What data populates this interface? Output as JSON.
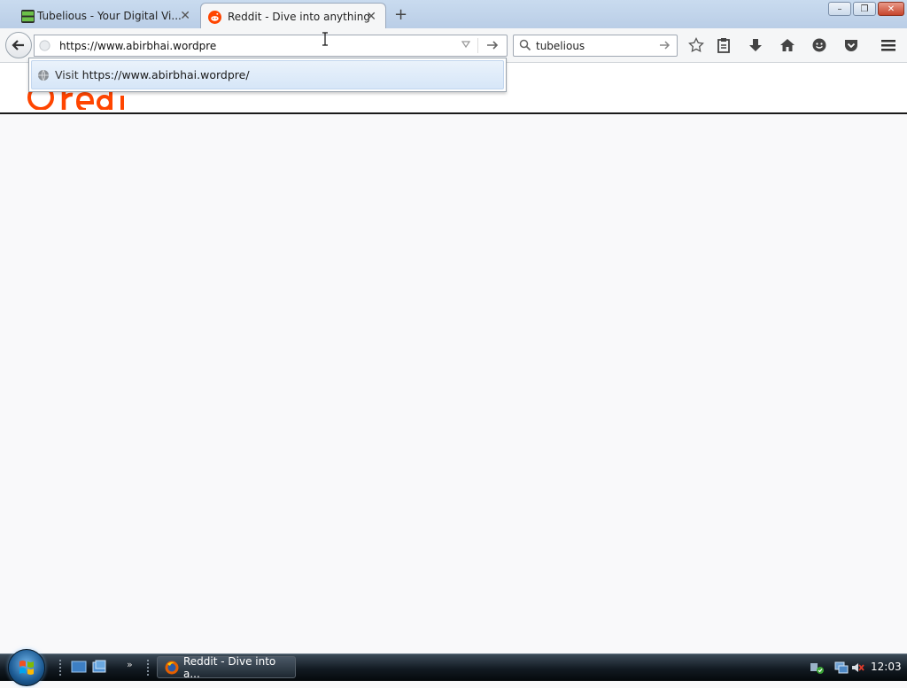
{
  "tabs": [
    {
      "title": "Tubelious - Your Digital Vi...",
      "favicon": "tubelious-favicon",
      "active": false
    },
    {
      "title": "Reddit - Dive into anything",
      "favicon": "reddit-favicon",
      "active": true
    }
  ],
  "new_tab_label": "+",
  "window_controls": {
    "minimize": "–",
    "maximize": "❐",
    "close": "✕"
  },
  "navbar": {
    "url_value": "https://www.abirbhai.wordpre",
    "search_value": "tubelious"
  },
  "autocomplete": {
    "prefix": "Visit",
    "url": "https://www.abirbhai.wordpre/"
  },
  "taskbar": {
    "task_label": "Reddit - Dive into a...",
    "clock": "12:03"
  },
  "colors": {
    "reddit_orange": "#ff4500",
    "tabstrip": "#c9dbef",
    "popup_highlight": "#d6e6f8"
  }
}
